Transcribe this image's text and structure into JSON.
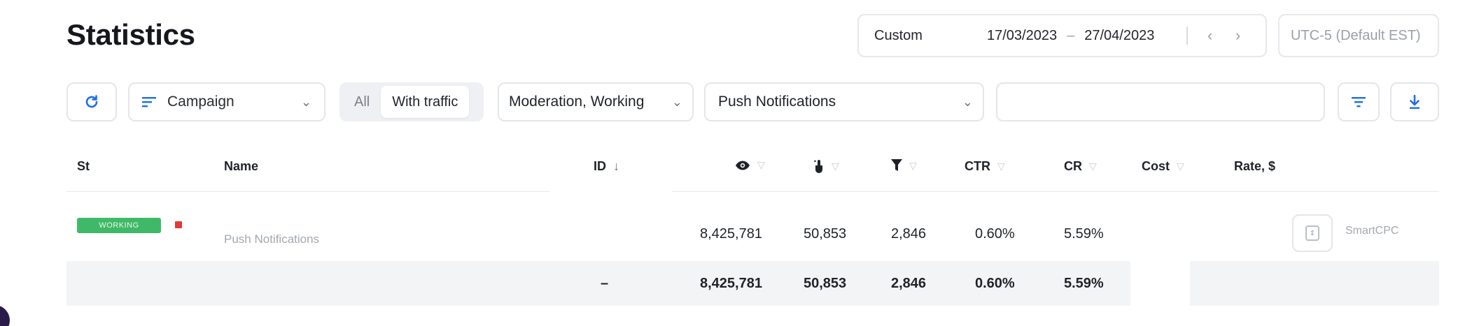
{
  "page": {
    "title": "Statistics"
  },
  "date_range": {
    "preset": "Custom",
    "start": "17/03/2023",
    "end": "27/04/2023",
    "prev_icon": "chevron-left-icon",
    "next_icon": "chevron-right-icon"
  },
  "timezone": {
    "label": "UTC-5 (Default EST)"
  },
  "toolbar": {
    "refresh_icon": "refresh-icon",
    "group_by": {
      "icon": "sort-lines-icon",
      "value": "Campaign"
    },
    "traffic_toggle": {
      "options": [
        "All",
        "With traffic"
      ],
      "selected": "With traffic"
    },
    "status_filter": {
      "value": "Moderation, Working"
    },
    "type_filter": {
      "value": "Push Notifications"
    },
    "search": {
      "value": "",
      "placeholder": ""
    },
    "filter_icon": "filter-lines-icon",
    "download_icon": "download-icon"
  },
  "table": {
    "columns": {
      "status": "St",
      "name": "Name",
      "id": "ID",
      "views": "eye-icon",
      "clicks": "click-icon",
      "conversions": "funnel-icon",
      "ctr": "CTR",
      "cr": "CR",
      "cost": "Cost",
      "rate": "Rate, $"
    },
    "id_sort_indicator": "↓",
    "rows": [
      {
        "status_badge": "WORKING",
        "name": "Push Notifications",
        "views": "8,425,781",
        "clicks": "50,853",
        "conversions": "2,846",
        "ctr": "0.60%",
        "cr": "5.59%",
        "rate_mode": "SmartCPC"
      }
    ],
    "totals": {
      "id": "–",
      "views": "8,425,781",
      "clicks": "50,853",
      "conversions": "2,846",
      "ctr": "0.60%",
      "cr": "5.59%"
    }
  },
  "colors": {
    "accent": "#1e6fe0",
    "working_badge": "#3fb968",
    "stop": "#e53935"
  }
}
